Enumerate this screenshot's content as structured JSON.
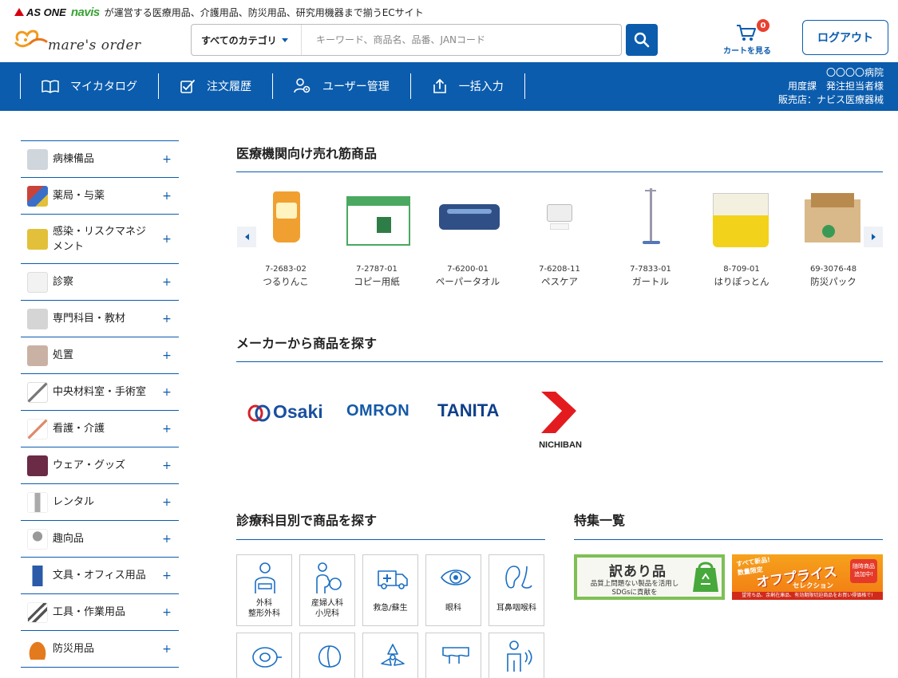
{
  "topline": {
    "asone": "AS ONE",
    "navis": "navis",
    "tagline": "が運営する医療用品、介護用品、防災用品、研究用機器まで揃うECサイト"
  },
  "brand": {
    "name": "mare's order"
  },
  "search": {
    "category_label": "すべてのカテゴリ",
    "placeholder": "キーワード、商品名、品番、JANコード"
  },
  "cart": {
    "label": "カートを見る",
    "count": "0"
  },
  "logout_label": "ログアウト",
  "nav": {
    "items": [
      {
        "label": "マイカタログ",
        "icon": "book-icon"
      },
      {
        "label": "注文履歴",
        "icon": "order-check-icon"
      },
      {
        "label": "ユーザー管理",
        "icon": "user-gear-icon"
      },
      {
        "label": "一括入力",
        "icon": "upload-icon"
      }
    ]
  },
  "account": {
    "hospital": "〇〇〇〇病院",
    "user": "用度課　発注担当者様",
    "dealer": "販売店：ナビス医療器械"
  },
  "sidebar": {
    "items": [
      {
        "label": "病棟備品",
        "color": "#cfd6dc"
      },
      {
        "label": "薬局・与薬",
        "color": "#c9433a"
      },
      {
        "label": "感染・リスクマネジメント",
        "color": "#e3c039"
      },
      {
        "label": "診察",
        "color": "#e8e8e8"
      },
      {
        "label": "専門科目・教材",
        "color": "#c7c7c7"
      },
      {
        "label": "処置",
        "color": "#d8c0b3"
      },
      {
        "label": "中央材料室・手術室",
        "color": "#8a8a8a"
      },
      {
        "label": "看護・介護",
        "color": "#f0e6da"
      },
      {
        "label": "ウェア・グッズ",
        "color": "#6b2a45"
      },
      {
        "label": "レンタル",
        "color": "#bfbfbf"
      },
      {
        "label": "趣向品",
        "color": "#9a9a9a"
      },
      {
        "label": "文具・オフィス用品",
        "color": "#2a5aa8"
      },
      {
        "label": "工具・作業用品",
        "color": "#555555"
      },
      {
        "label": "防災用品",
        "color": "#e47a1e"
      }
    ],
    "plus": "+"
  },
  "sections": {
    "bestsellers": "医療機関向け売れ筋商品",
    "makers": "メーカーから商品を探す",
    "departments": "診療科目別で商品を探す",
    "features": "特集一覧"
  },
  "products": [
    {
      "code": "7-2683-02",
      "name": "つるりんこ"
    },
    {
      "code": "7-2787-01",
      "name": "コピー用紙"
    },
    {
      "code": "7-6200-01",
      "name": "ペーパータオル"
    },
    {
      "code": "7-6208-11",
      "name": "ペスケア"
    },
    {
      "code": "7-7833-01",
      "name": "ガートル"
    },
    {
      "code": "8-709-01",
      "name": "はりぽっとん"
    },
    {
      "code": "69-3076-48",
      "name": "防災パック"
    }
  ],
  "makers": {
    "osaki": "Osaki",
    "omron": "OMRON",
    "tanita": "TANITA",
    "nichiban": "NICHIBAN"
  },
  "departments": [
    {
      "line1": "外科",
      "line2": "整形外科"
    },
    {
      "line1": "産婦人科",
      "line2": "小児科"
    },
    {
      "line1": "救急/蘇生",
      "line2": ""
    },
    {
      "line1": "眼科",
      "line2": ""
    },
    {
      "line1": "耳鼻咽喉科",
      "line2": ""
    }
  ],
  "features": {
    "outlet_title": "訳あり品",
    "outlet_sub1": "品質上問題ない製品を活用し",
    "outlet_sub2": "SDGsに貢献を",
    "offprice_top": "すべて新品!",
    "offprice_limited": "数量限定",
    "offprice_title": "オフプライス",
    "offprice_sub": "セレクション",
    "offprice_badge1": "随時商品",
    "offprice_badge2": "追加中!",
    "offprice_note": "望常ち品、余剰在庫品、有効期限切迫商品をお買い得価格で!"
  },
  "colors": {
    "brand_blue": "#0b5cad",
    "badge_red": "#e9402f"
  }
}
